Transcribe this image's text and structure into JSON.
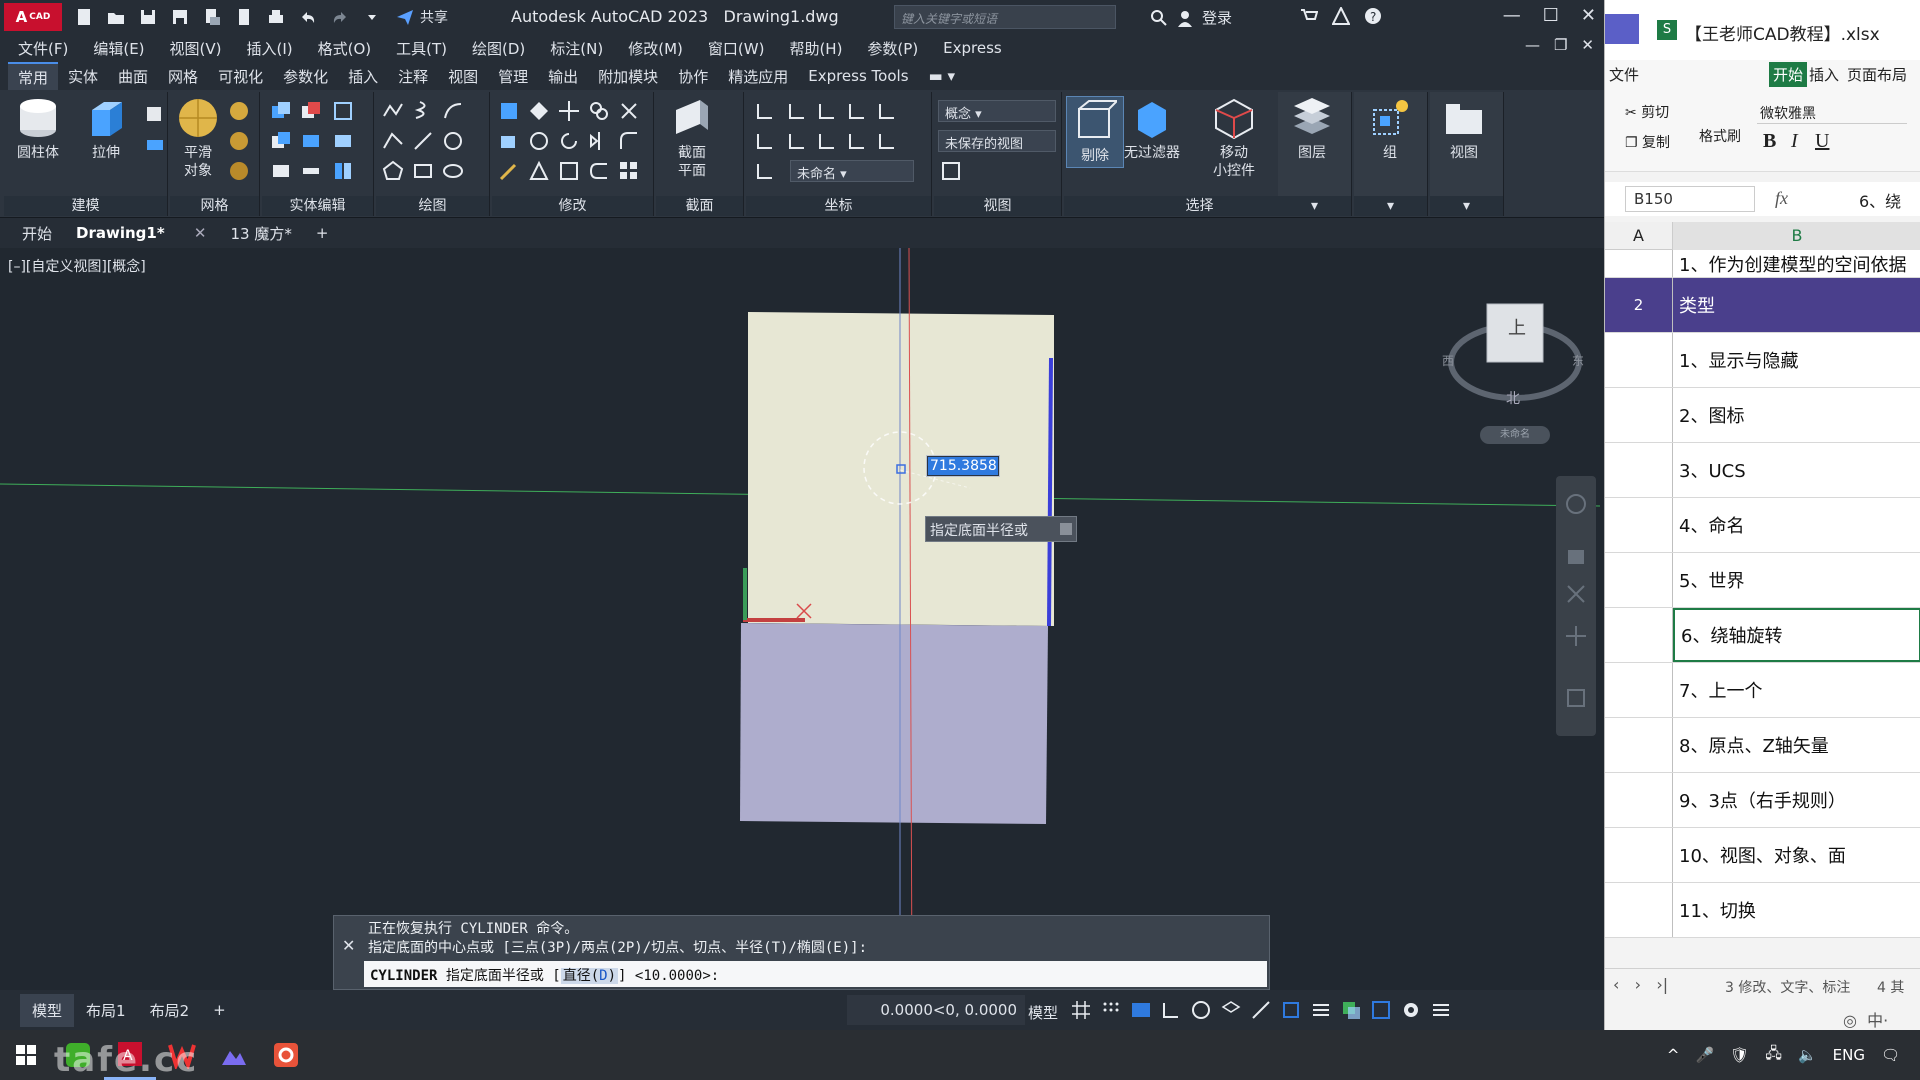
{
  "acad": {
    "title_app": "Autodesk AutoCAD 2023",
    "title_file": "Drawing1.dwg",
    "logo": "A",
    "logo_small": "CAD",
    "share_label": "共享",
    "search_placeholder": "键入关键字或短语",
    "login_label": "登录",
    "menus": [
      "文件(F)",
      "编辑(E)",
      "视图(V)",
      "插入(I)",
      "格式(O)",
      "工具(T)",
      "绘图(D)",
      "标注(N)",
      "修改(M)",
      "窗口(W)",
      "帮助(H)",
      "参数(P)",
      "Express"
    ],
    "ribbon_tabs": [
      "常用",
      "实体",
      "曲面",
      "网格",
      "可视化",
      "参数化",
      "插入",
      "注释",
      "视图",
      "管理",
      "输出",
      "附加模块",
      "协作",
      "精选应用",
      "Express Tools"
    ],
    "active_tab": "常用",
    "panels": {
      "modeling": "建模",
      "mesh": "网格",
      "solid_edit": "实体编辑",
      "draw": "绘图",
      "modify": "修改",
      "section": "截面",
      "coordinates": "坐标",
      "view": "视图",
      "selection": "选择"
    },
    "buttons": {
      "cylinder": "圆柱体",
      "extrude": "拉伸",
      "smooth_l1": "平滑",
      "smooth_l2": "对象",
      "section_plane_l1": "截面",
      "section_plane_l2": "平面",
      "culling": "剔除",
      "no_filter": "无过滤器",
      "move_gizmo_l1": "移动",
      "move_gizmo_l2": "小控件",
      "layers": "图层",
      "groups": "组",
      "view": "视图"
    },
    "dropdowns": {
      "visual_style": "概念",
      "unsaved_view": "未保存的视图",
      "ucs_name": "未命名"
    },
    "file_tabs": [
      "开始",
      "Drawing1*",
      "13 魔方*"
    ],
    "active_file_tab": "Drawing1*",
    "viewport_label": "[–][自定义视图][概念]",
    "dynamic_input_value": "715.3858",
    "dynamic_prompt": "指定底面半径或",
    "viewcube": {
      "face": "上",
      "north": "北",
      "west": "西",
      "east": "东"
    },
    "wcs_label": "未命名",
    "command_history": [
      "正在恢复执行 CYLINDER 命令。",
      "指定底面的中心点或 [三点(3P)/两点(2P)/切点、切点、半径(T)/椭圆(E)]:"
    ],
    "command_input": {
      "command": "CYLINDER",
      "text": "指定底面半径或",
      "option_prefix": "直径(",
      "option_key": "D",
      "option_suffix": ")",
      "default": "<10.0000>:"
    },
    "layout_tabs": [
      "模型",
      "布局1",
      "布局2"
    ],
    "active_layout": "模型",
    "coordinates": "0.0000<0, 0.0000",
    "model_button": "模型"
  },
  "excel": {
    "filename": "【王老师CAD教程】.xlsx",
    "menu_file": "文件",
    "tab_start": "开始",
    "tab_insert": "插入",
    "tab_layout": "页面布局",
    "cut": "剪切",
    "copy": "复制",
    "format_painter": "格式刷",
    "font": "微软雅黑",
    "name_box": "B150",
    "fx": "fx",
    "formula_preview": "6、绕",
    "columns": [
      "A",
      "B"
    ],
    "rows": [
      {
        "num": "",
        "text": "1、作为创建模型的空间依据"
      },
      {
        "num": "2",
        "text": "类型"
      },
      {
        "num": "",
        "text": "1、显示与隐藏"
      },
      {
        "num": "",
        "text": "2、图标"
      },
      {
        "num": "",
        "text": "3、UCS"
      },
      {
        "num": "",
        "text": "4、命名"
      },
      {
        "num": "",
        "text": "5、世界"
      },
      {
        "num": "",
        "text": "6、绕轴旋转"
      },
      {
        "num": "",
        "text": "7、上一个"
      },
      {
        "num": "",
        "text": "8、原点、Z轴矢量"
      },
      {
        "num": "",
        "text": "9、3点（右手规则）"
      },
      {
        "num": "",
        "text": "10、视图、对象、面"
      },
      {
        "num": "",
        "text": "11、切换"
      }
    ],
    "sheet_tab": "3 修改、文字、标注",
    "sheet_tab2": "4 其"
  },
  "taskbar": {
    "watermark": "tafe.cc",
    "lang": "ENG"
  },
  "colors": {
    "acad_bg": "#212830",
    "accent_blue": "#2f7adf",
    "excel_header_row": "#4a3f8c",
    "selection_green": "#1e7b45"
  }
}
